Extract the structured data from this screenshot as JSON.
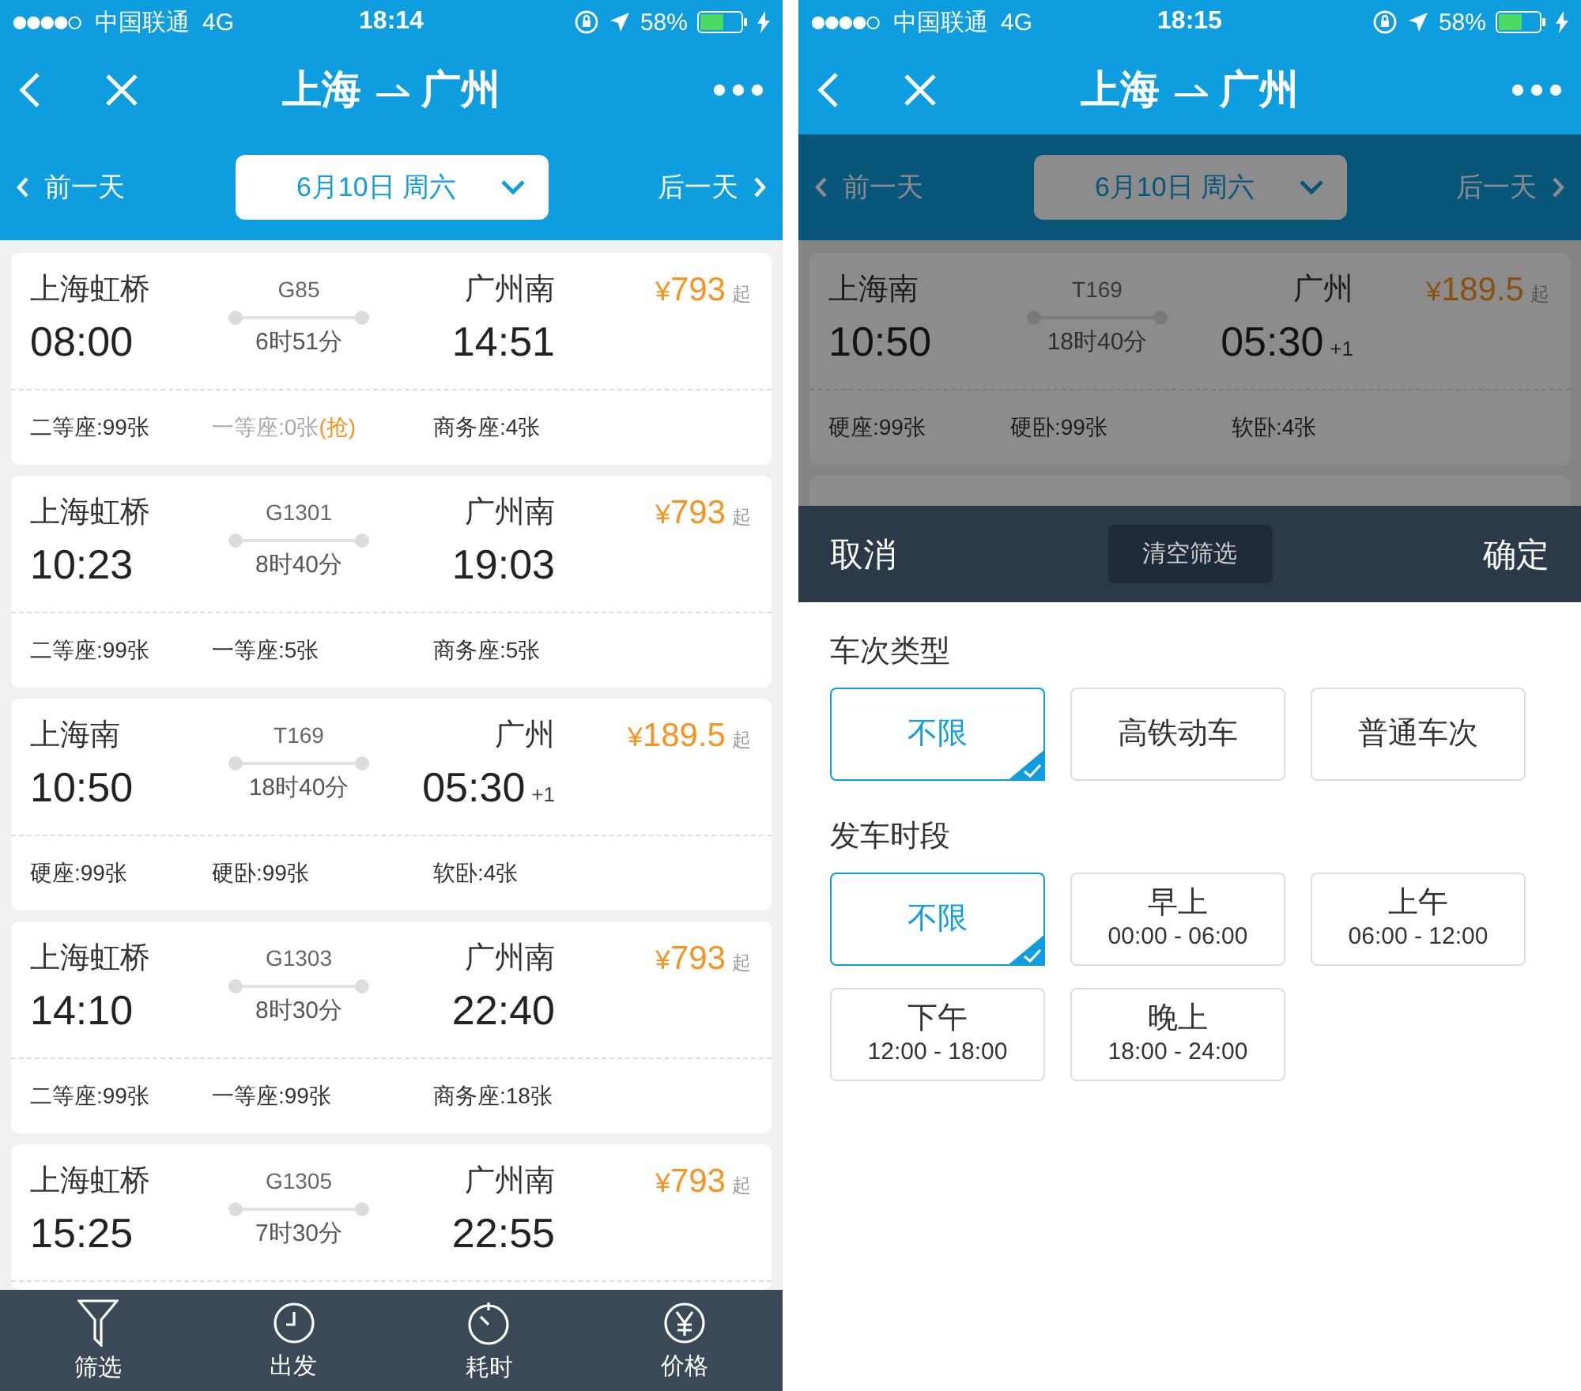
{
  "screens": [
    {
      "status_bar": {
        "carrier": "中国联通",
        "network": "4G",
        "time": "18:14",
        "battery": "58%"
      },
      "nav": {
        "from": "上海",
        "to": "广州"
      },
      "date_bar": {
        "prev": "前一天",
        "date": "6月10日 周六",
        "next": "后一天"
      },
      "trains": [
        {
          "from_station": "上海虹桥",
          "train_no": "G85",
          "to_station": "广州南",
          "currency": "¥",
          "price": "793",
          "price_unit": "起",
          "depart": "08:00",
          "duration": "6时51分",
          "arrive": "14:51",
          "seats": [
            {
              "text": "二等座:99张",
              "sold_out": false
            },
            {
              "text": "一等座:0张",
              "sold_out": true,
              "extra": "(抢)"
            },
            {
              "text": "商务座:4张",
              "sold_out": false
            }
          ]
        },
        {
          "from_station": "上海虹桥",
          "train_no": "G1301",
          "to_station": "广州南",
          "currency": "¥",
          "price": "793",
          "price_unit": "起",
          "depart": "10:23",
          "duration": "8时40分",
          "arrive": "19:03",
          "seats": [
            {
              "text": "二等座:99张",
              "sold_out": false
            },
            {
              "text": "一等座:5张",
              "sold_out": false
            },
            {
              "text": "商务座:5张",
              "sold_out": false
            }
          ]
        },
        {
          "from_station": "上海南",
          "train_no": "T169",
          "to_station": "广州",
          "currency": "¥",
          "price": "189.5",
          "price_unit": "起",
          "depart": "10:50",
          "duration": "18时40分",
          "arrive": "05:30",
          "next_day": "+1",
          "seats": [
            {
              "text": "硬座:99张",
              "sold_out": false
            },
            {
              "text": "硬卧:99张",
              "sold_out": false
            },
            {
              "text": "软卧:4张",
              "sold_out": false
            }
          ]
        },
        {
          "from_station": "上海虹桥",
          "train_no": "G1303",
          "to_station": "广州南",
          "currency": "¥",
          "price": "793",
          "price_unit": "起",
          "depart": "14:10",
          "duration": "8时30分",
          "arrive": "22:40",
          "seats": [
            {
              "text": "二等座:99张",
              "sold_out": false
            },
            {
              "text": "一等座:99张",
              "sold_out": false
            },
            {
              "text": "商务座:18张",
              "sold_out": false
            }
          ]
        },
        {
          "from_station": "上海虹桥",
          "train_no": "G1305",
          "to_station": "广州南",
          "currency": "¥",
          "price": "793",
          "price_unit": "起",
          "depart": "15:25",
          "duration": "7时30分",
          "arrive": "22:55"
        }
      ],
      "tab_bar": [
        {
          "kind": "filter",
          "label": "筛选"
        },
        {
          "kind": "clock",
          "label": "出发"
        },
        {
          "kind": "timer",
          "label": "耗时"
        },
        {
          "kind": "price",
          "label": "价格"
        }
      ]
    },
    {
      "status_bar": {
        "carrier": "中国联通",
        "network": "4G",
        "time": "18:15",
        "battery": "58%"
      },
      "nav": {
        "from": "上海",
        "to": "广州"
      },
      "date_bar": {
        "prev": "前一天",
        "date": "6月10日 周六",
        "next": "后一天"
      },
      "trains": [
        {
          "from_station": "上海南",
          "train_no": "T169",
          "to_station": "广州",
          "currency": "¥",
          "price": "189.5",
          "price_unit": "起",
          "depart": "10:50",
          "duration": "18时40分",
          "arrive": "05:30",
          "next_day": "+1",
          "seats": [
            {
              "text": "硬座:99张",
              "sold_out": false
            },
            {
              "text": "硬卧:99张",
              "sold_out": false
            },
            {
              "text": "软卧:4张",
              "sold_out": false
            }
          ]
        }
      ],
      "filter": {
        "cancel": "取消",
        "clear": "清空筛选",
        "confirm": "确定",
        "groups": [
          {
            "title": "车次类型",
            "options": [
              {
                "label": "不限",
                "selected": true
              },
              {
                "label": "高铁动车",
                "selected": false
              },
              {
                "label": "普通车次",
                "selected": false
              }
            ]
          },
          {
            "title": "发车时段",
            "options": [
              {
                "label": "不限",
                "selected": true
              },
              {
                "label": "早上",
                "range": "00:00 - 06:00",
                "selected": false
              },
              {
                "label": "上午",
                "range": "06:00 - 12:00",
                "selected": false
              },
              {
                "label": "下午",
                "range": "12:00 - 18:00",
                "selected": false
              },
              {
                "label": "晚上",
                "range": "18:00 - 24:00",
                "selected": false
              }
            ]
          }
        ]
      }
    }
  ]
}
